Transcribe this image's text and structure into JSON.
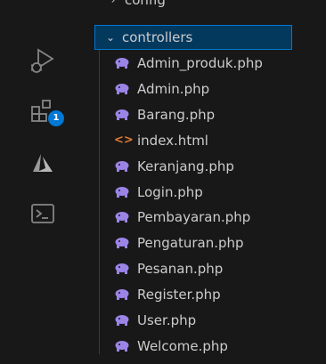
{
  "activity_bar": {
    "items": [
      {
        "name": "run-debug-icon"
      },
      {
        "name": "extensions-icon",
        "badge": "1"
      },
      {
        "name": "azure-icon"
      },
      {
        "name": "terminal-icon"
      }
    ],
    "badge_color": "#0078d4"
  },
  "explorer": {
    "partial_top_folder": "config",
    "folder": {
      "label": "controllers",
      "expanded": true
    },
    "files": [
      {
        "label": "Admin_produk.php",
        "icon": "php-elephant-icon"
      },
      {
        "label": "Admin.php",
        "icon": "php-elephant-icon"
      },
      {
        "label": "Barang.php",
        "icon": "php-elephant-icon"
      },
      {
        "label": "index.html",
        "icon": "html-icon"
      },
      {
        "label": "Keranjang.php",
        "icon": "php-elephant-icon"
      },
      {
        "label": "Login.php",
        "icon": "php-elephant-icon"
      },
      {
        "label": "Pembayaran.php",
        "icon": "php-elephant-icon"
      },
      {
        "label": "Pengaturan.php",
        "icon": "php-elephant-icon"
      },
      {
        "label": "Pesanan.php",
        "icon": "php-elephant-icon"
      },
      {
        "label": "Register.php",
        "icon": "php-elephant-icon"
      },
      {
        "label": "User.php",
        "icon": "php-elephant-icon"
      },
      {
        "label": "Welcome.php",
        "icon": "php-elephant-icon"
      }
    ],
    "colors": {
      "php_icon": "#9b84e6",
      "html_icon": "#e37933",
      "selection_border": "#0078d4",
      "selection_bg": "#04395e",
      "text": "#cccccc"
    }
  }
}
